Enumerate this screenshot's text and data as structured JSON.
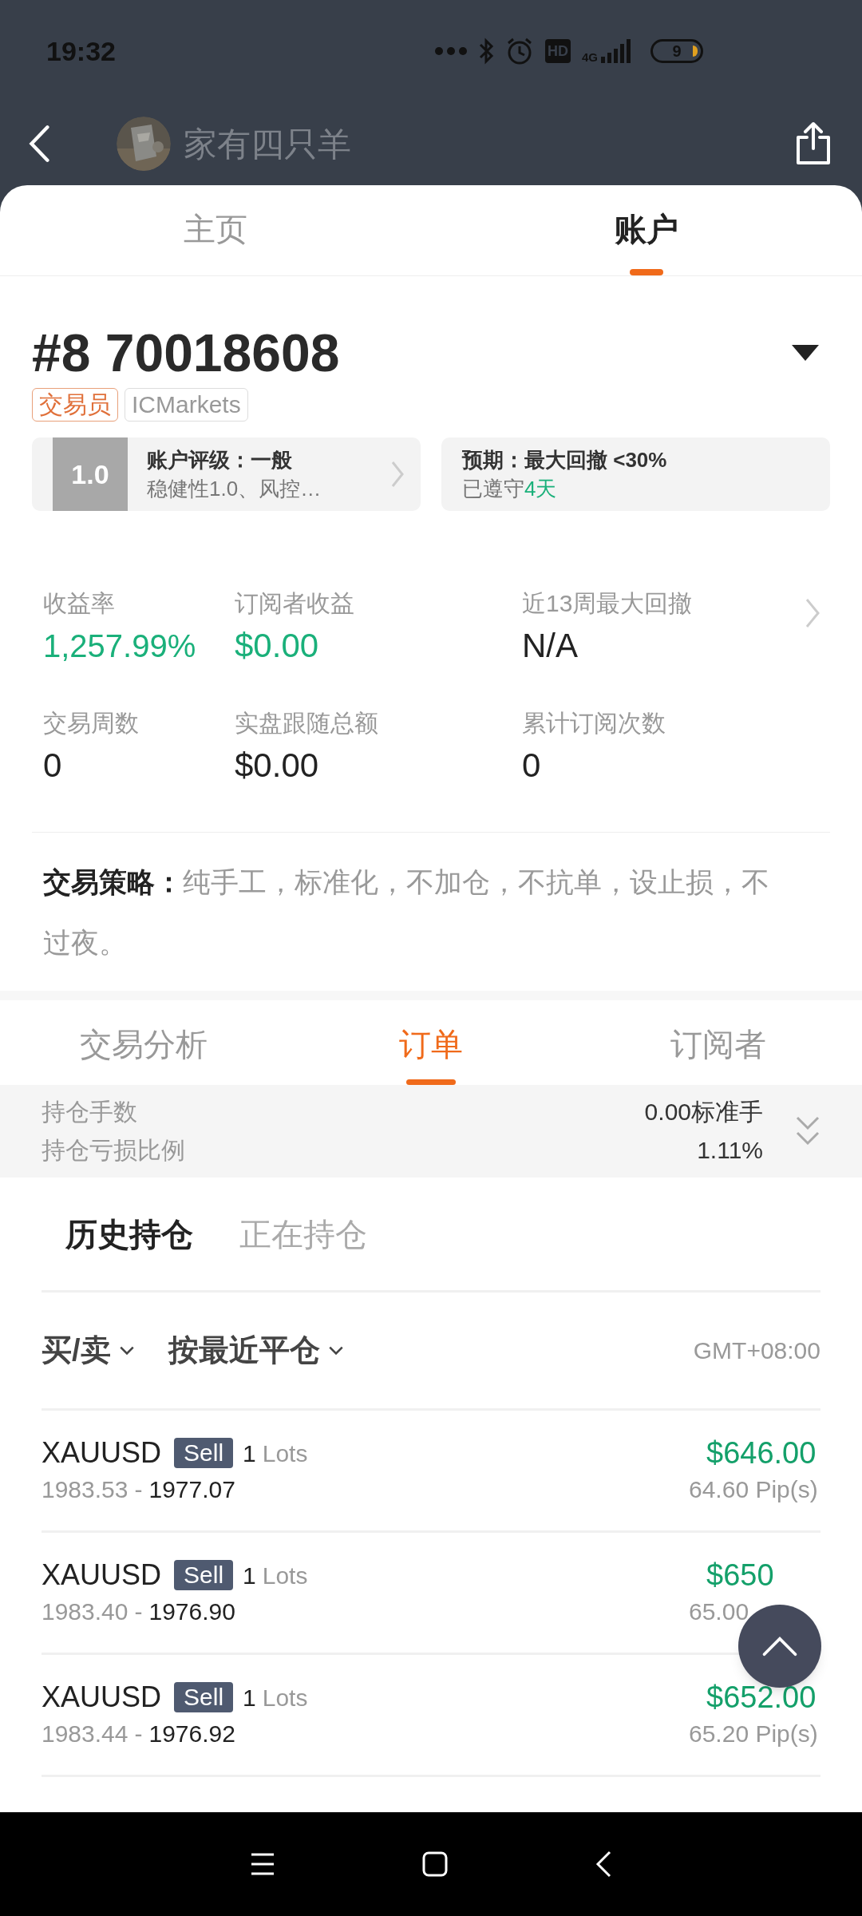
{
  "status_bar": {
    "time": "19:32",
    "hd": "HD",
    "network": "4G",
    "battery": "9"
  },
  "header": {
    "title": "家有四只羊"
  },
  "tabs": [
    {
      "label": "主页",
      "selected": false
    },
    {
      "label": "账户",
      "selected": true
    }
  ],
  "account": {
    "number": "#8 70018608",
    "tags": [
      {
        "label": "交易员",
        "kind": "role"
      },
      {
        "label": "ICMarkets",
        "kind": "broker"
      }
    ]
  },
  "cards": [
    {
      "badge": "1.0",
      "title": "账户评级：一般",
      "subtitle": "稳健性1.0、风控…"
    },
    {
      "title": "预期：最大回撤 <30%",
      "subtitle": "已遵守",
      "highlight": "4天"
    }
  ],
  "stats": [
    {
      "label": "收益率",
      "value": "1,257.99%",
      "highlighted": true
    },
    {
      "label": "订阅者收益",
      "value": "$0.00",
      "highlighted": true
    },
    {
      "label": "近13周最大回撤",
      "value": "N/A",
      "highlighted": false
    },
    {
      "label": "交易周数",
      "value": "0",
      "highlighted": false
    },
    {
      "label": "实盘跟随总额",
      "value": "$0.00",
      "highlighted": false
    },
    {
      "label": "累计订阅次数",
      "value": "0",
      "highlighted": false
    }
  ],
  "strategy": {
    "label": "交易策略：",
    "text": "纯手工，标准化，不加仓，不抗单，设止损，不过夜。"
  },
  "sub_tabs": [
    {
      "label": "交易分析",
      "selected": false
    },
    {
      "label": "订单",
      "selected": true
    },
    {
      "label": "订阅者",
      "selected": false
    }
  ],
  "summary": [
    {
      "label": "持仓手数",
      "value": "0.00标准手"
    },
    {
      "label": "持仓亏损比例",
      "value": "1.11%"
    }
  ],
  "position_tabs": [
    {
      "label": "历史持仓",
      "selected": true
    },
    {
      "label": "正在持仓",
      "selected": false
    }
  ],
  "filters": [
    {
      "label": "买/卖"
    },
    {
      "label": "按最近平仓"
    }
  ],
  "timezone": "GMT+08:00",
  "orders": [
    {
      "symbol": "XAUUSD",
      "side": "Sell",
      "lots": "1",
      "lots_unit": "Lots",
      "open": "1983.53",
      "separator": "-",
      "close": "1977.07",
      "profit": "$646.00",
      "pips": "64.60 Pip(s)"
    },
    {
      "symbol": "XAUUSD",
      "side": "Sell",
      "lots": "1",
      "lots_unit": "Lots",
      "open": "1983.40",
      "separator": "-",
      "close": "1976.90",
      "profit": "$650",
      "pips": "65.00"
    },
    {
      "symbol": "XAUUSD",
      "side": "Sell",
      "lots": "1",
      "lots_unit": "Lots",
      "open": "1983.44",
      "separator": "-",
      "close": "1976.92",
      "profit": "$652.00",
      "pips": "65.20 Pip(s)"
    }
  ]
}
